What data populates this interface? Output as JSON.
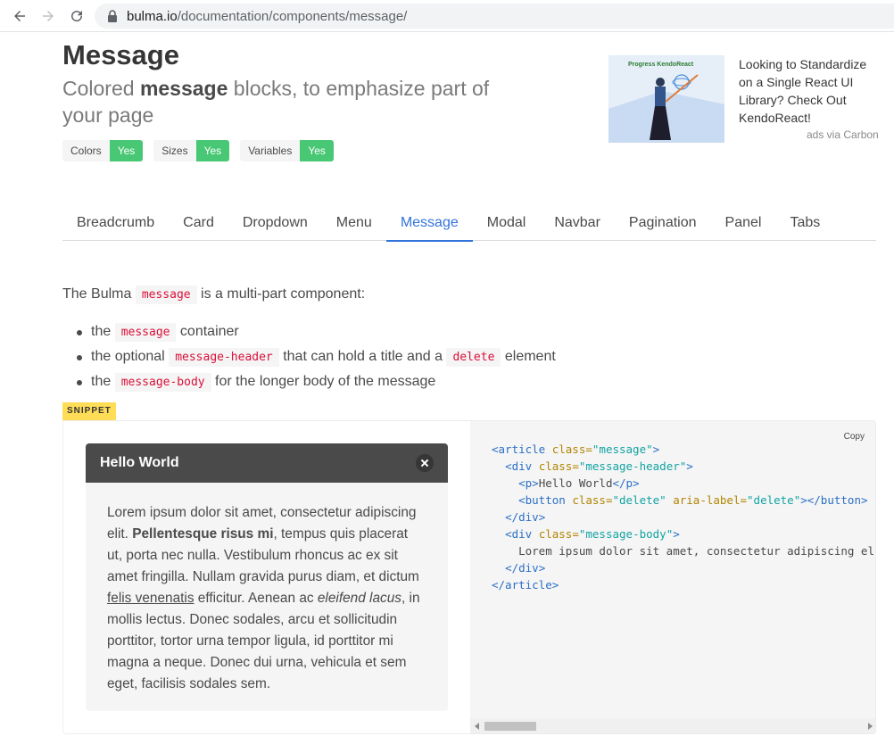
{
  "browser": {
    "url_host": "bulma.io",
    "url_path": "/documentation/components/message/"
  },
  "header": {
    "title": "Message",
    "subtitle_pre": "Colored ",
    "subtitle_bold": "message",
    "subtitle_post": " blocks, to emphasize part of your page"
  },
  "tags": [
    {
      "key": "Colors",
      "value": "Yes"
    },
    {
      "key": "Sizes",
      "value": "Yes"
    },
    {
      "key": "Variables",
      "value": "Yes"
    }
  ],
  "ad": {
    "brand": "Progress KendoReact",
    "text": "Looking to Standardize on a Single React UI Library? Check Out KendoReact!",
    "via": "ads via Carbon"
  },
  "tabs": [
    "Breadcrumb",
    "Card",
    "Dropdown",
    "Menu",
    "Message",
    "Modal",
    "Navbar",
    "Pagination",
    "Panel",
    "Tabs"
  ],
  "active_tab": "Message",
  "intro": {
    "pre": "The Bulma ",
    "code": "message",
    "post": " is a multi-part component:"
  },
  "list": {
    "item1": {
      "pre": "the ",
      "code": "message",
      "post": " container"
    },
    "item2": {
      "pre": "the optional ",
      "code": "message-header",
      "mid": " that can hold a title and a ",
      "code2": "delete",
      "post": " element"
    },
    "item3": {
      "pre": "the ",
      "code": "message-body",
      "post": " for the longer body of the message"
    }
  },
  "snippet": {
    "label": "SNIPPET",
    "copy": "Copy",
    "message_title": "Hello World",
    "body": {
      "t1": "Lorem ipsum dolor sit amet, consectetur adipiscing elit. ",
      "bold": "Pellentesque risus mi",
      "t2": ", tempus quis placerat ut, porta nec nulla. Vestibulum rhoncus ac ex sit amet fringilla. Nullam gravida purus diam, et dictum ",
      "link": "felis venenatis",
      "t3": " efficitur. Aenean ac ",
      "italic": "eleifend lacus",
      "t4": ", in mollis lectus. Donec sodales, arcu et sollicitudin porttitor, tortor urna tempor ligula, id porttitor mi magna a neque. Donec dui urna, vehicula et sem eget, facilisis sodales sem."
    },
    "code": {
      "l1_tag_open": "<article ",
      "l1_attr": "class=",
      "l1_str": "\"message\"",
      "l1_close": ">",
      "l2_tag": "<div ",
      "l2_attr": "class=",
      "l2_str": "\"message-header\"",
      "l2_close": ">",
      "l3_open": "<p>",
      "l3_text": "Hello World",
      "l3_close": "</p>",
      "l4_tag": "<button ",
      "l4_attr1": "class=",
      "l4_str1": "\"delete\"",
      "l4_attr2": " aria-label=",
      "l4_str2": "\"delete\"",
      "l4_close": "></button>",
      "l5": "</div>",
      "l6_tag": "<div ",
      "l6_attr": "class=",
      "l6_str": "\"message-body\"",
      "l6_close": ">",
      "l7": "Lorem ipsum dolor sit amet, consectetur adipiscing elit. <",
      "l8": "</div>",
      "l9": "</article>"
    }
  }
}
